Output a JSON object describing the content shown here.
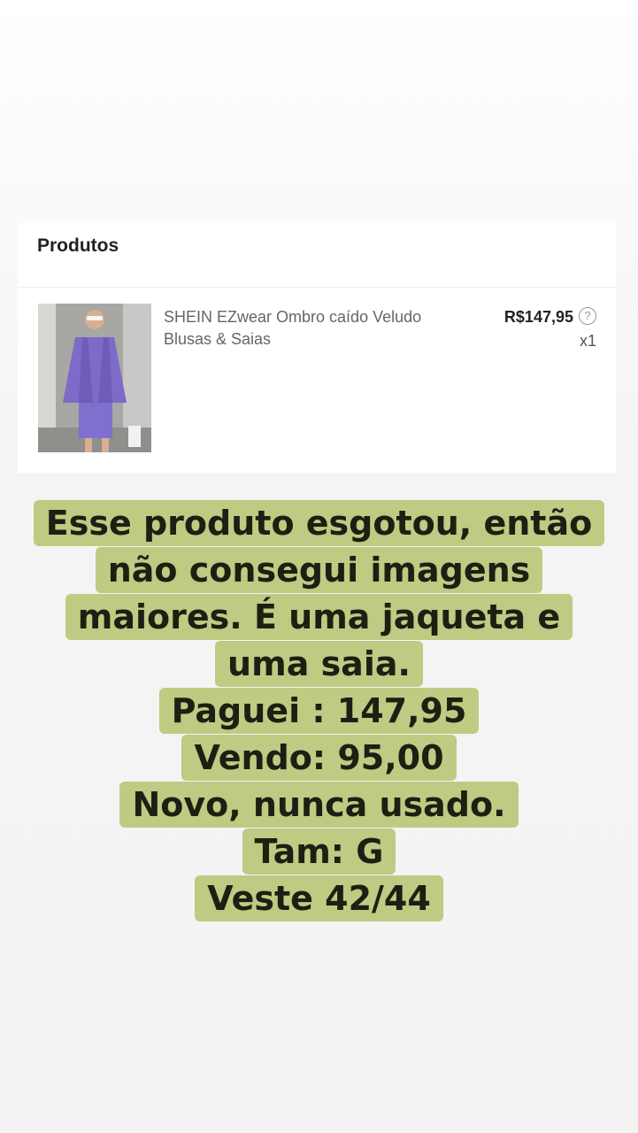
{
  "section": {
    "title": "Produtos"
  },
  "product": {
    "name": "SHEIN EZwear Ombro caído Veludo Blusas & Saias",
    "price": "R$147,95",
    "quantity": "x1",
    "image_description_icon": "product-photo-icon",
    "help_icon": "question-circle-icon"
  },
  "caption": {
    "lines": [
      "Esse produto esgotou, então",
      "não consegui imagens",
      "maiores. É uma jaqueta e",
      "uma saia.",
      "Paguei : 147,95",
      "Vendo: 95,00",
      "Novo, nunca usado.",
      "Tam: G",
      "Veste 42/44"
    ]
  },
  "colors": {
    "caption_highlight": "#bdcb83",
    "caption_text": "#1d1f12"
  }
}
